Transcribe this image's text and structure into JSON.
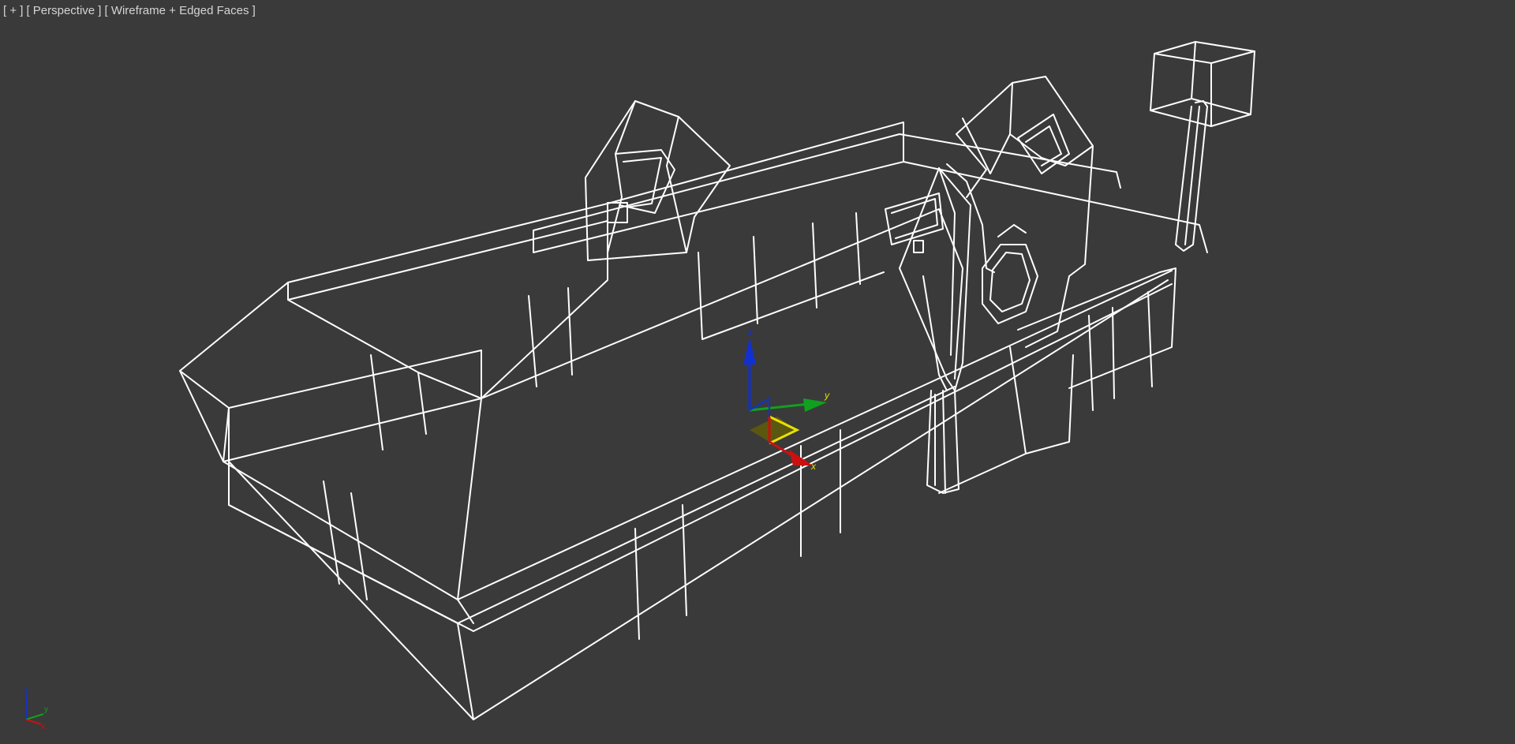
{
  "viewport": {
    "menu_label": "[ + ]",
    "view_label": "[ Perspective ]",
    "shading_label": "[ Wireframe + Edged Faces ]"
  },
  "gizmo": {
    "x_label": "x",
    "y_label": "y",
    "z_label": "z",
    "x_color": "#cc1010",
    "y_color": "#10a020",
    "z_color": "#1030d0",
    "plane_color": "#e8e000"
  },
  "corner_axis": {
    "x_label": "x",
    "y_label": "y",
    "z_label": "z"
  },
  "colors": {
    "background": "#3a3a3a",
    "wireframe": "#ffffff",
    "label_text": "#d4d4d4"
  }
}
